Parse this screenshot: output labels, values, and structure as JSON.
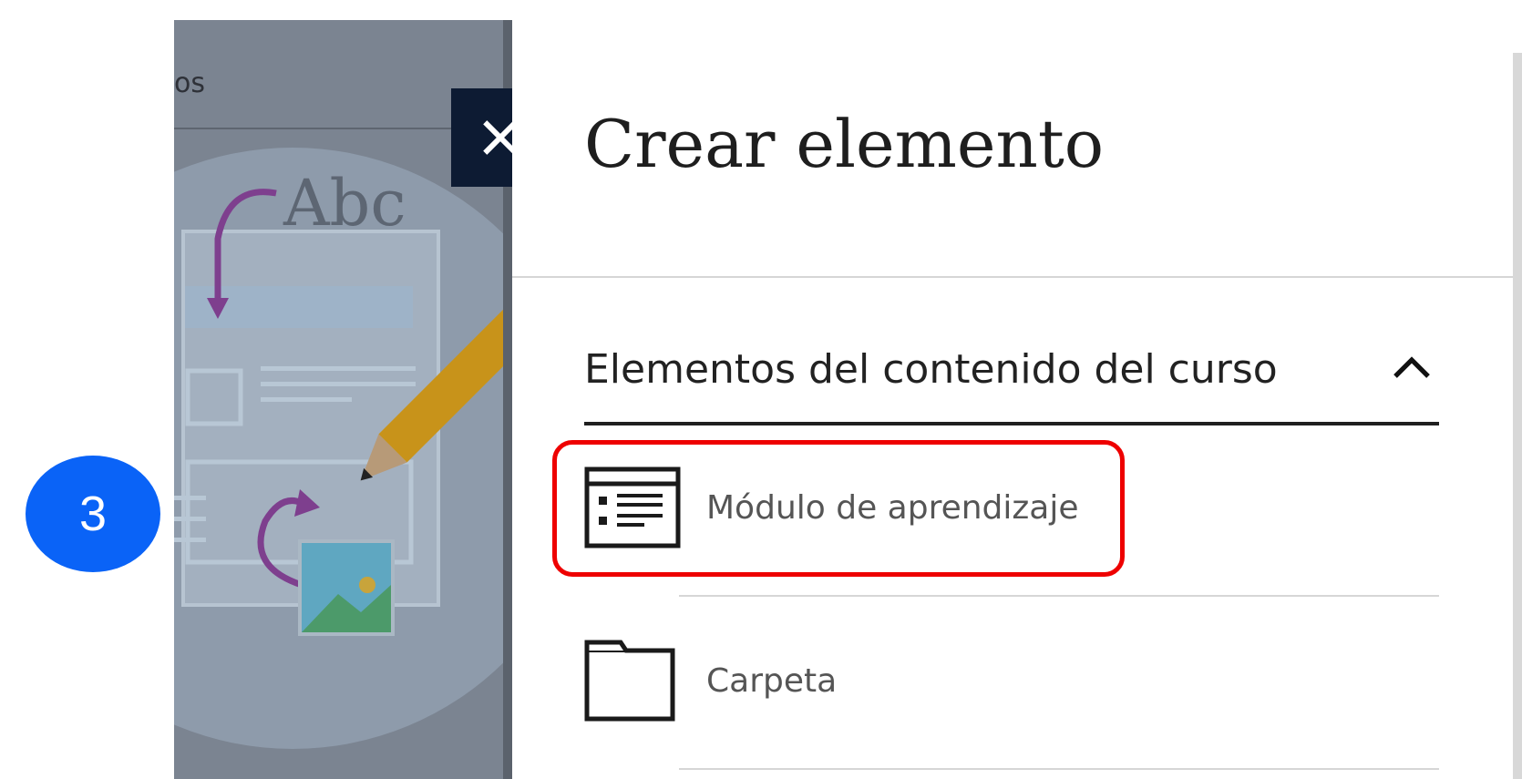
{
  "background": {
    "tab_text": "os",
    "illustration_text": "Abc"
  },
  "drawer": {
    "close_label": "×",
    "title": "Crear elemento",
    "section": {
      "title": "Elementos del contenido del curso",
      "expanded": true,
      "items": [
        {
          "label": "Módulo de aprendizaje",
          "icon": "learning-module-icon",
          "highlighted": true
        },
        {
          "label": "Carpeta",
          "icon": "folder-icon",
          "highlighted": false
        }
      ]
    }
  },
  "annotation": {
    "step_number": "3",
    "highlight_color": "#ee0000",
    "badge_color": "#0a63f7"
  }
}
